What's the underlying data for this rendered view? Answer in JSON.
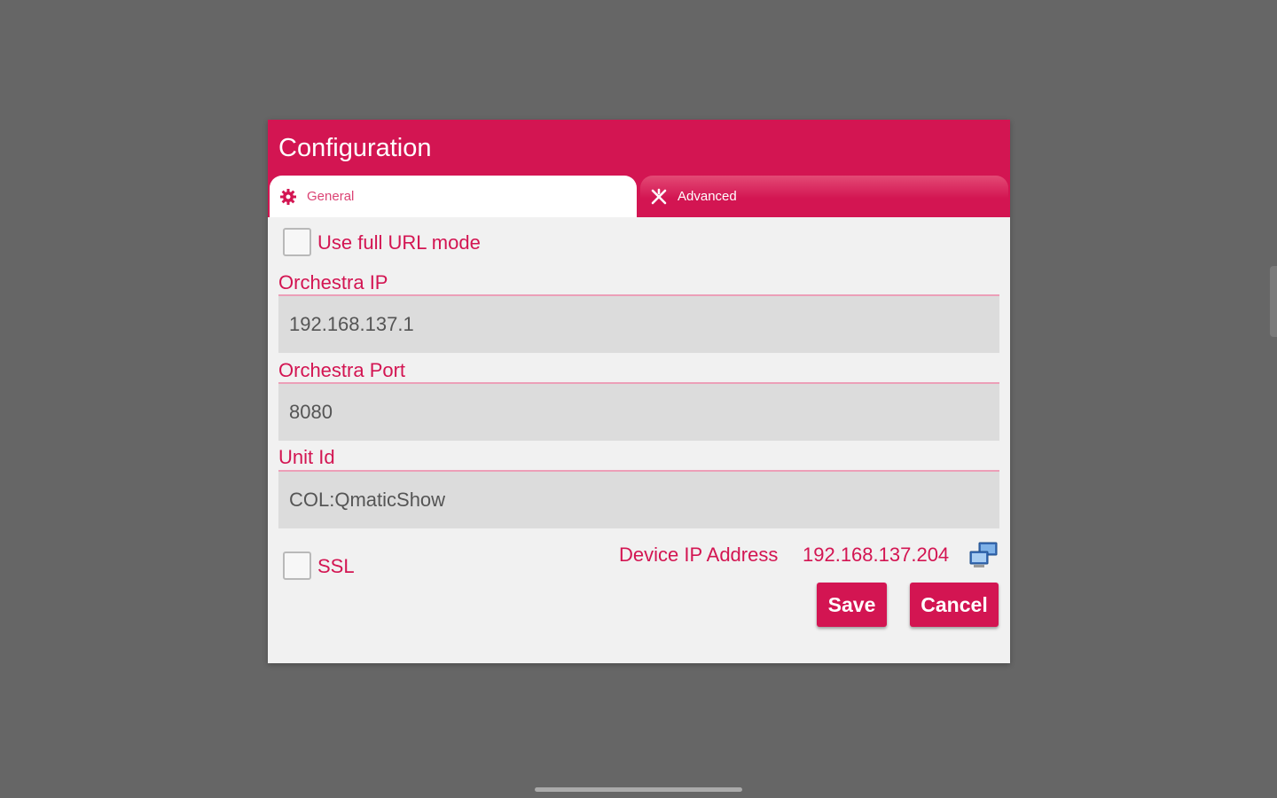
{
  "dialog": {
    "title": "Configuration",
    "colors": {
      "accent": "#d31552",
      "background": "#f1f1f1",
      "overlay": "#666666"
    },
    "tabs": [
      {
        "label": "General",
        "icon": "gear-icon",
        "selected": true
      },
      {
        "label": "Advanced",
        "icon": "tools-icon",
        "selected": false
      }
    ]
  },
  "form": {
    "full_url_mode": {
      "label": "Use full URL mode",
      "checked": false
    },
    "orchestra_ip": {
      "label": "Orchestra IP",
      "value": "192.168.137.1"
    },
    "orchestra_port": {
      "label": "Orchestra Port",
      "value": "8080"
    },
    "unit_id": {
      "label": "Unit Id",
      "value": "COL:QmaticShow"
    },
    "ssl": {
      "label": "SSL",
      "checked": false
    },
    "device_ip": {
      "label": "Device IP Address",
      "value": "192.168.137.204",
      "icon": "network-icon"
    }
  },
  "buttons": {
    "save": "Save",
    "cancel": "Cancel"
  }
}
